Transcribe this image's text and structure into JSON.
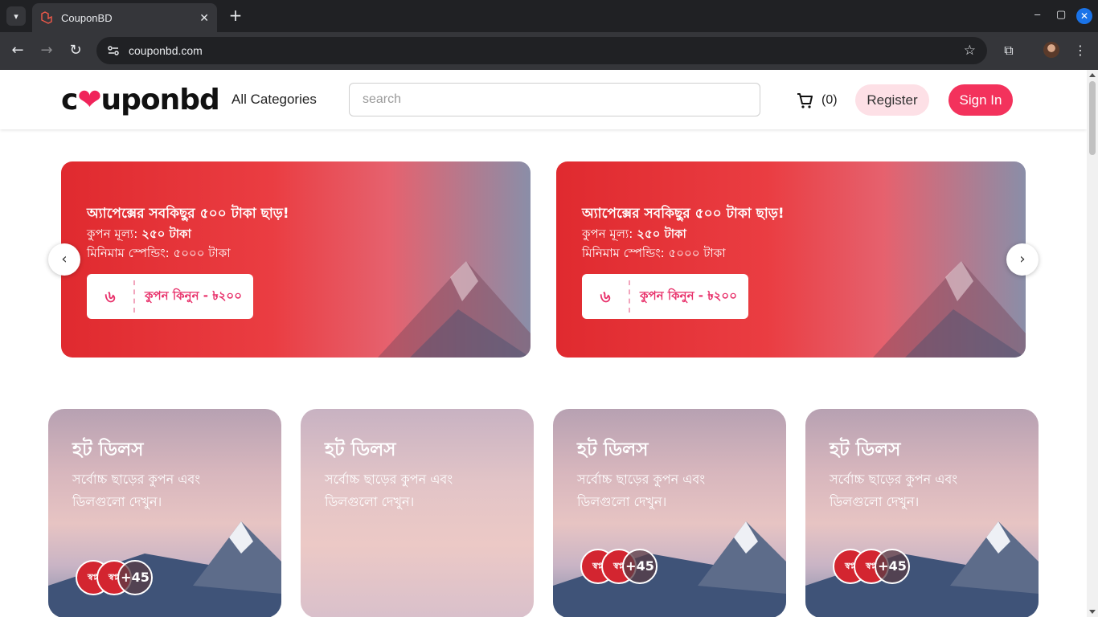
{
  "browser": {
    "tab_title": "CouponBD",
    "tab_close": "✕",
    "new_tab": "+",
    "url": "couponbd.com",
    "controls": {
      "minimize": "–",
      "maximize": "▢",
      "close": "✕"
    }
  },
  "header": {
    "logo_text_left": "c",
    "logo_heart": "❤",
    "logo_text_right": "uponbd",
    "all_categories": "All Categories",
    "search_placeholder": "search",
    "cart_count": "(0)",
    "register": "Register",
    "sign_in": "Sign In"
  },
  "banners": [
    {
      "title": "অ্যাপেক্সের সবকিছুর ৫০০ টাকা ছাড়!",
      "value_label": "কুপন মূল্য: ",
      "value": "২৫০ টাকা",
      "min_spend": "মিনিমাম স্পেন্ডিং: ৫০০০ টাকা",
      "button_icon": "৬",
      "button_label": "কুপন কিনুন - ৳২০০"
    },
    {
      "title": "অ্যাপেক্সের সবকিছুর ৫০০ টাকা ছাড়!",
      "value_label": "কুপন মূল্য: ",
      "value": "২৫০ টাকা",
      "min_spend": "মিনিমাম স্পেন্ডিং: ৫০০০ টাকা",
      "button_icon": "৬",
      "button_label": "কুপন কিনুন - ৳২০০"
    }
  ],
  "carousel": {
    "prev": "‹",
    "next": "›"
  },
  "cards": [
    {
      "title": "হট ডিলস",
      "desc": "সর্বোচ্চ ছাড়ের কুপন এবং ডিলগুলো দেখুন।",
      "more": "+45",
      "avatar_label": "স্বপ্ন"
    },
    {
      "title": "হট ডিলস",
      "desc": "সর্বোচ্চ ছাড়ের কুপন এবং ডিলগুলো দেখুন।"
    },
    {
      "title": "হট ডিলস",
      "desc": "সর্বোচ্চ ছাড়ের কুপন এবং ডিলগুলো দেখুন।",
      "more": "+45",
      "avatar_label": "স্বপ্ন"
    },
    {
      "title": "হট ডিলস",
      "desc": "সর্বোচ্চ ছাড়ের কুপন এবং ডিলগুলো দেখুন।",
      "more": "+45",
      "avatar_label": "স্বপ্ন"
    }
  ],
  "colors": {
    "brand": "#f3325c",
    "banner_red": "#e02a2f",
    "register_bg": "#fde0e6"
  }
}
